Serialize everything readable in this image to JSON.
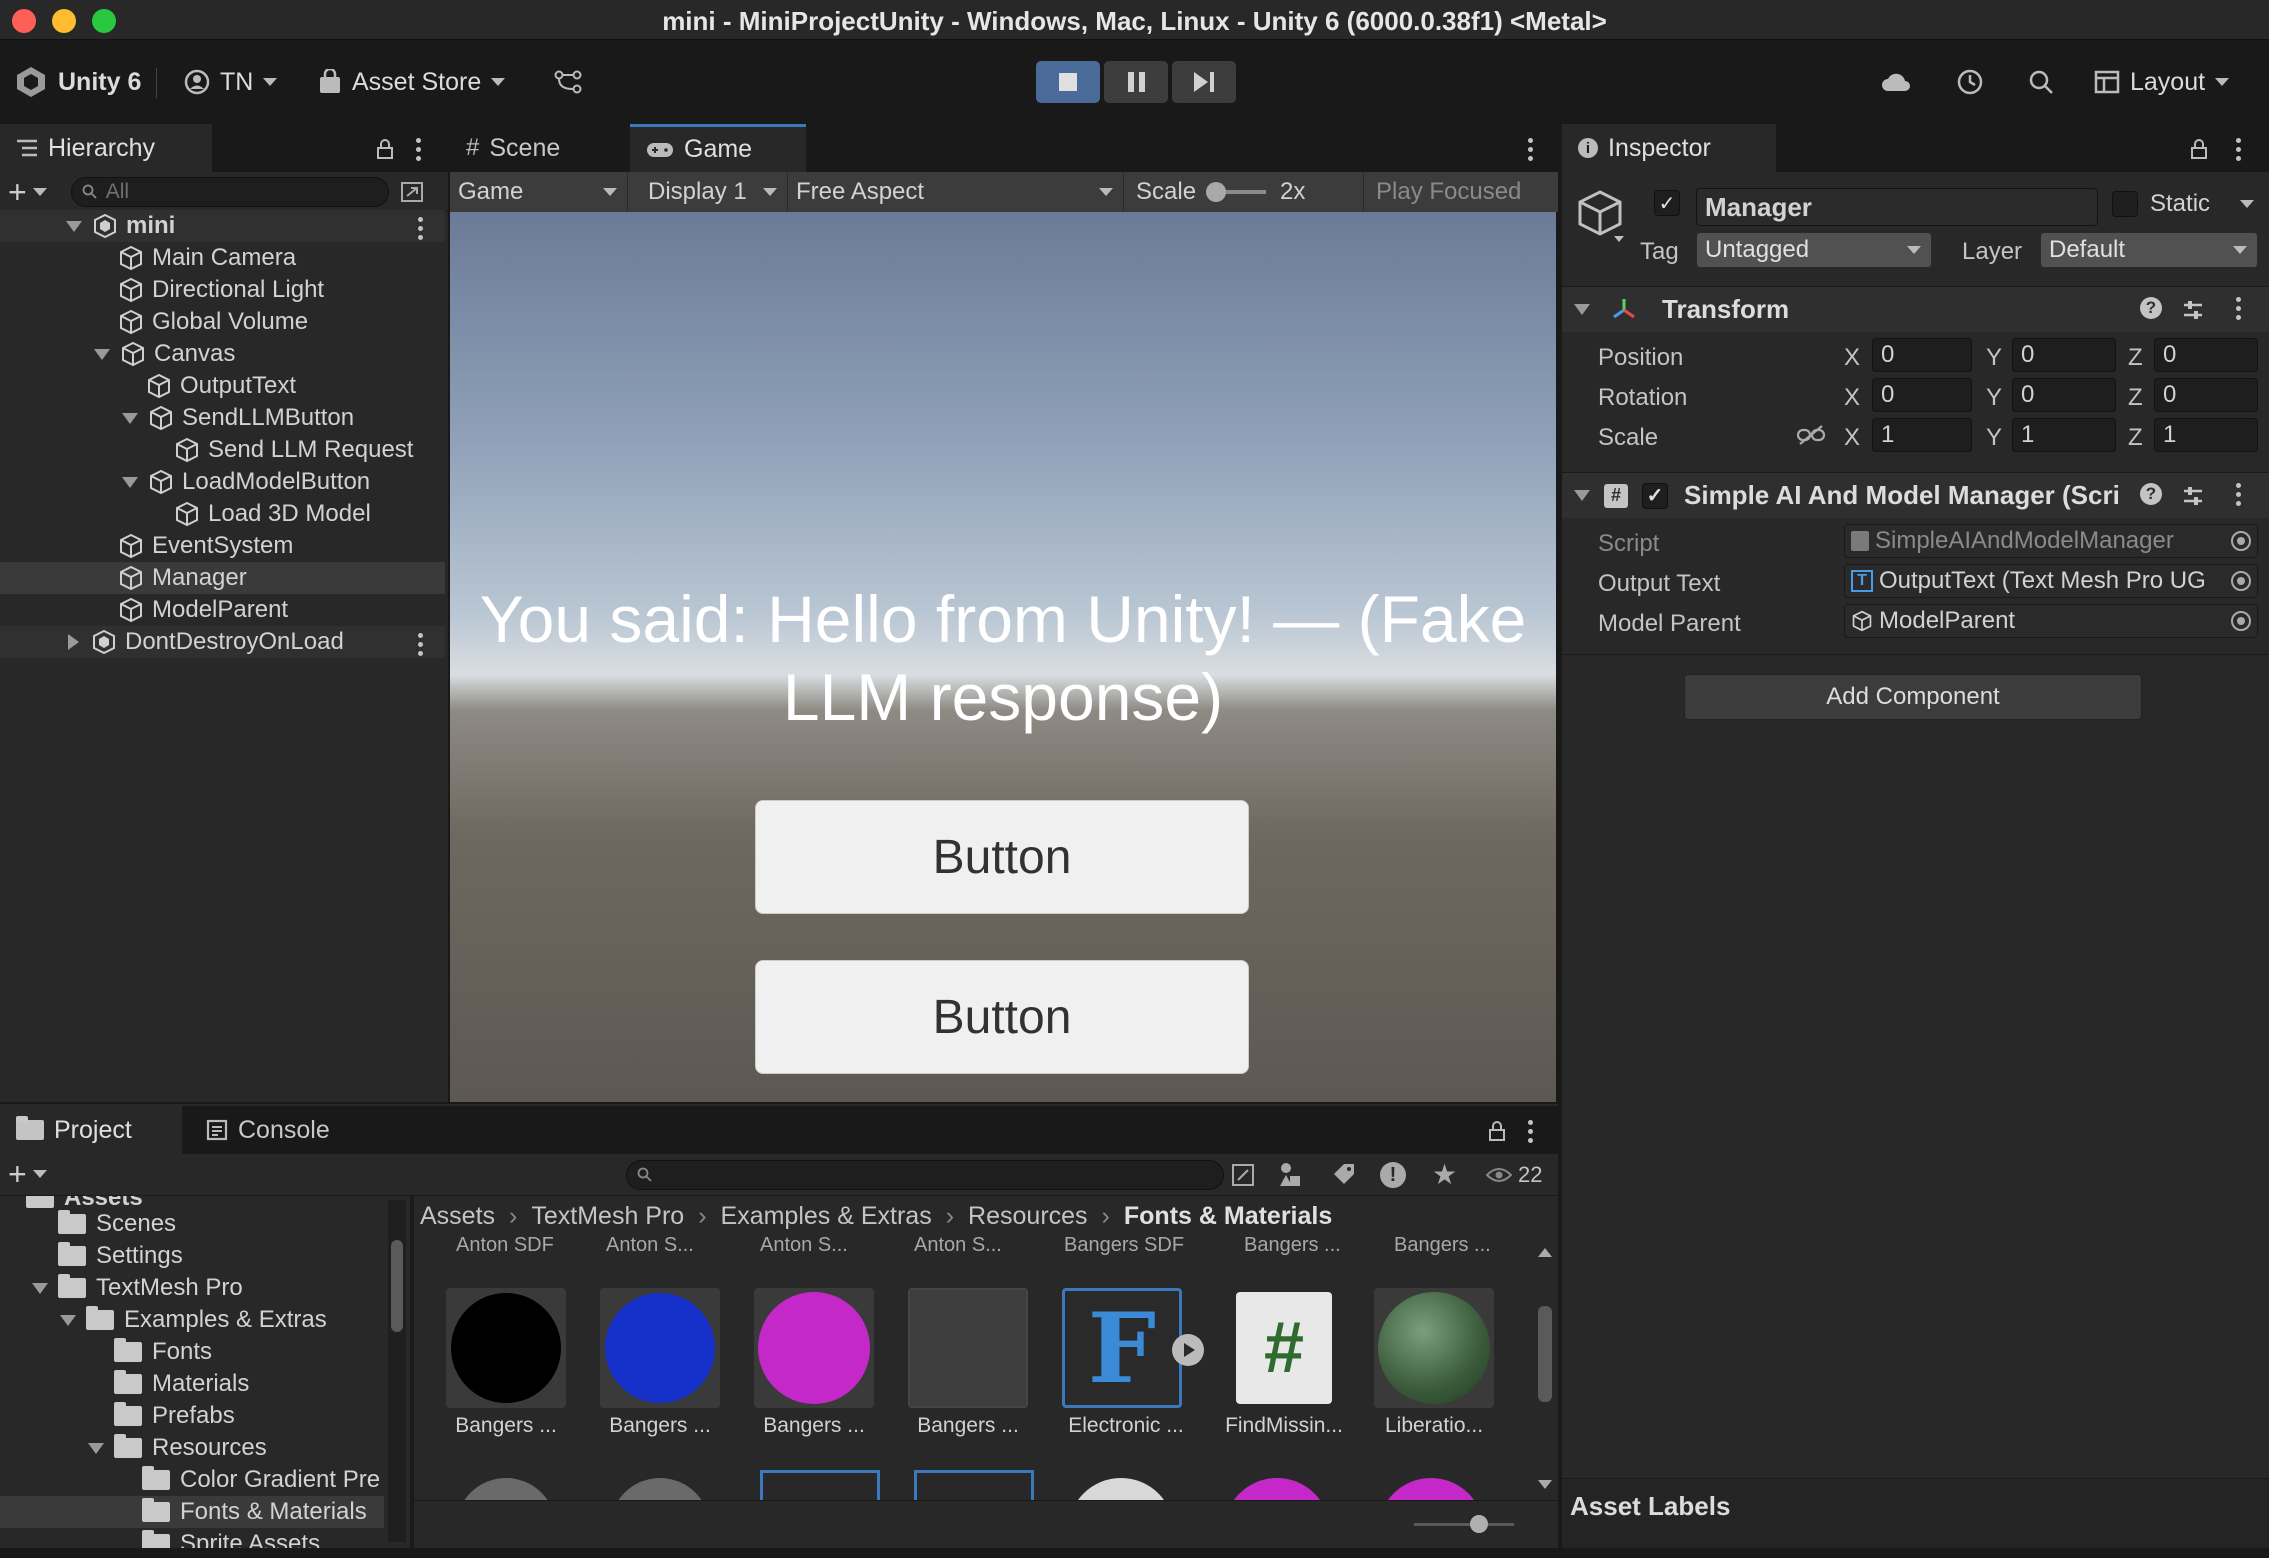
{
  "window": {
    "title": "mini - MiniProjectUnity - Windows, Mac, Linux - Unity 6 (6000.0.38f1) <Metal>"
  },
  "toolbar": {
    "unity_label": "Unity 6",
    "account_label": "TN",
    "asset_store_label": "Asset Store",
    "layout_label": "Layout"
  },
  "hierarchy": {
    "tab_label": "Hierarchy",
    "search_placeholder": "All",
    "items": [
      {
        "label": "mini"
      },
      {
        "label": "Main Camera"
      },
      {
        "label": "Directional Light"
      },
      {
        "label": "Global Volume"
      },
      {
        "label": "Canvas"
      },
      {
        "label": "OutputText"
      },
      {
        "label": "SendLLMButton"
      },
      {
        "label": "Send LLM Request"
      },
      {
        "label": "LoadModelButton"
      },
      {
        "label": "Load 3D Model"
      },
      {
        "label": "EventSystem"
      },
      {
        "label": "Manager"
      },
      {
        "label": "ModelParent"
      },
      {
        "label": "DontDestroyOnLoad"
      }
    ]
  },
  "center_tabs": {
    "scene_label": "Scene",
    "game_label": "Game"
  },
  "game_toolbar": {
    "mode": "Game",
    "display": "Display 1",
    "aspect": "Free Aspect",
    "scale_label": "Scale",
    "scale_value": "2x",
    "play_focused": "Play Focused"
  },
  "game_view": {
    "output_text": "You said: Hello from Unity! — (Fake LLM response)",
    "button1_label": "Button",
    "button2_label": "Button"
  },
  "inspector": {
    "tab_label": "Inspector",
    "object_name": "Manager",
    "static_label": "Static",
    "tag_label": "Tag",
    "tag_value": "Untagged",
    "layer_label": "Layer",
    "layer_value": "Default",
    "transform": {
      "title": "Transform",
      "position_label": "Position",
      "rotation_label": "Rotation",
      "scale_label": "Scale",
      "x": "X",
      "y": "Y",
      "z": "Z",
      "position": [
        "0",
        "0",
        "0"
      ],
      "rotation": [
        "0",
        "0",
        "0"
      ],
      "scale": [
        "1",
        "1",
        "1"
      ]
    },
    "component": {
      "title": "Simple AI And Model Manager (Scri",
      "script_label": "Script",
      "script_value": "SimpleAIAndModelManager",
      "output_text_label": "Output Text",
      "output_text_value": "OutputText (Text Mesh Pro UG",
      "model_parent_label": "Model Parent",
      "model_parent_value": "ModelParent"
    },
    "add_component_label": "Add Component",
    "asset_labels": "Asset Labels"
  },
  "bottom_tabs": {
    "project_label": "Project",
    "console_label": "Console",
    "visible_count": "22"
  },
  "project_tree": {
    "partial_top": "Assets",
    "items": [
      {
        "label": "Scenes"
      },
      {
        "label": "Settings"
      },
      {
        "label": "TextMesh Pro"
      },
      {
        "label": "Examples & Extras"
      },
      {
        "label": "Fonts"
      },
      {
        "label": "Materials"
      },
      {
        "label": "Prefabs"
      },
      {
        "label": "Resources"
      },
      {
        "label": "Color Gradient Pre"
      },
      {
        "label": "Fonts & Materials"
      },
      {
        "label": "Sprite Assets"
      }
    ]
  },
  "breadcrumb": {
    "items": [
      "Assets",
      "TextMesh Pro",
      "Examples & Extras",
      "Resources",
      "Fonts & Materials"
    ]
  },
  "assets": {
    "top_row_labels": [
      "Anton SDF",
      "Anton S...",
      "Anton S...",
      "Anton S...",
      "Bangers SDF",
      "Bangers ...",
      "Bangers ..."
    ],
    "row_labels": [
      "Bangers ...",
      "Bangers ...",
      "Bangers ...",
      "Bangers ...",
      "Electronic ...",
      "FindMissin...",
      "Liberatio..."
    ],
    "colors": {
      "tile_black": "#000000",
      "tile_blue": "#1530c8",
      "tile_magenta": "#c428c8",
      "accent": "#3a79bb"
    }
  }
}
